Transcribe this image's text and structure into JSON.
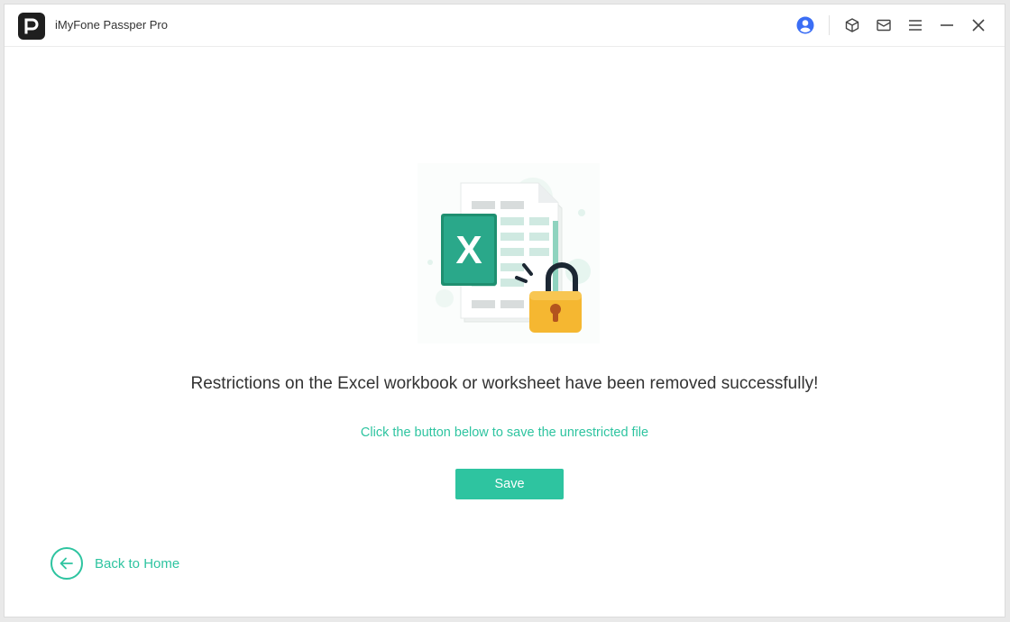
{
  "app": {
    "title": "iMyFone Passper Pro"
  },
  "titlebar": {
    "icons": [
      "account-icon",
      "cube-icon",
      "mail-icon",
      "menu-icon",
      "minimize-icon",
      "close-icon"
    ]
  },
  "illustration": {
    "badge_letter": "X",
    "icons": [
      "excel-file-icon",
      "unlocked-padlock-icon"
    ]
  },
  "main": {
    "headline": "Restrictions on the Excel workbook or worksheet have been removed successfully!",
    "subtext": "Click the button below to save the unrestricted file",
    "save_label": "Save",
    "back_label": "Back to Home"
  },
  "colors": {
    "accent": "#2ec4a0",
    "excel_green": "#2aa88a",
    "lock_gold": "#f5b731",
    "account_blue": "#3b6ef5"
  }
}
